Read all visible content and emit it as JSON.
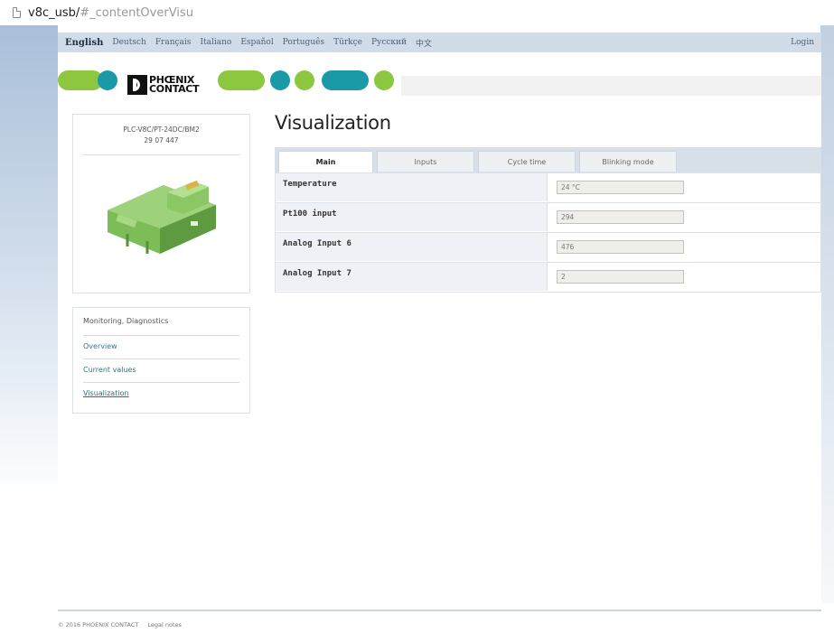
{
  "browser": {
    "url_host": "v8c_usb/",
    "url_hash": "#_contentOverVisu"
  },
  "languages": [
    "English",
    "Deutsch",
    "Français",
    "Italiano",
    "Español",
    "Português",
    "Türkçe",
    "Русский",
    "中文"
  ],
  "login_label": "Login",
  "logo": {
    "line1": "PHŒNIX",
    "line2": "CONTACT"
  },
  "brand_colors": {
    "green": "#8dc63f",
    "teal": "#1a9aa6"
  },
  "device": {
    "name": "PLC-V8C/PT-24DC/BM2",
    "code": "29 07 447"
  },
  "menu": {
    "title": "Monitoring, Diagnostics",
    "items": [
      "Overview",
      "Current values",
      "Visualization"
    ],
    "active_item": "Visualization"
  },
  "page_title": "Visualization",
  "tabs": [
    "Main",
    "Inputs",
    "Cycle time",
    "Blinking mode"
  ],
  "active_tab": "Main",
  "rows": [
    {
      "label": "Temperature",
      "value": "24 °C"
    },
    {
      "label": "Pt100 input",
      "value": "294"
    },
    {
      "label": "Analog Input 6",
      "value": "476"
    },
    {
      "label": "Analog Input 7",
      "value": "2"
    }
  ],
  "footer": {
    "copyright": "© 2016 PHOENIX CONTACT",
    "legal": "Legal notes"
  }
}
